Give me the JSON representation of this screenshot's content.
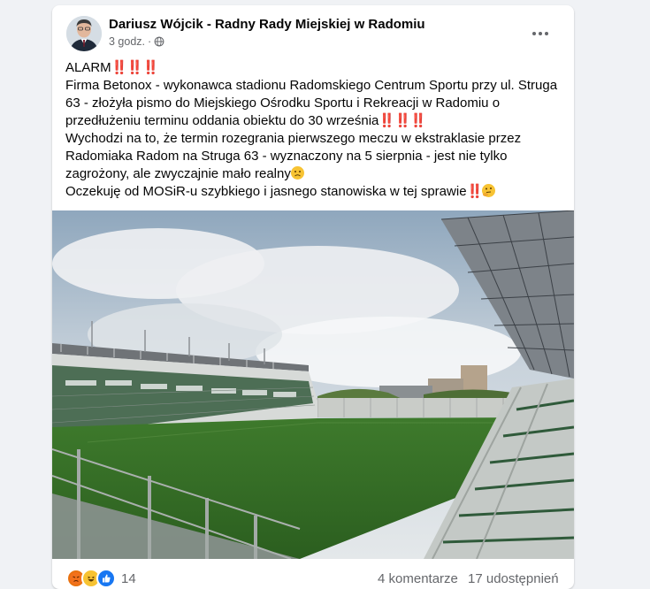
{
  "post": {
    "author": "Dariusz Wójcik - Radny Rady Miejskiej w Radomiu",
    "time": "3 godz.",
    "separator": "·",
    "audience_icon": "globe-icon",
    "more_icon": "more-options-icon",
    "text": {
      "line1_word": "ALARM",
      "alarm_marks": "‼️‼️‼️",
      "para1": "Firma Betonox - wykonawca stadionu Radomskiego Centrum Sportu przy ul. Struga 63 - złożyła pismo do Miejskiego Ośrodku Sportu i Rekreacji w Radomiu o przedłużeniu terminu oddania obiektu do 30 września",
      "para1_marks": "‼️‼️‼️",
      "para2": "Wychodzi na to, że termin rozegrania pierwszego meczu w ekstraklasie przez Radomiaka Radom na Struga 63 - wyznaczony na 5 sierpnia - jest nie tylko zagrożony, ale zwyczajnie mało realny",
      "para3": "Oczekuję od MOSiR-u szybkiego i jasnego stanowiska w tej sprawie",
      "para3_marks": "‼️"
    },
    "photo_alt": "Stadium photo"
  },
  "footer": {
    "reactions_count": "14",
    "comments": "4 komentarze",
    "shares": "17 udostępnień"
  },
  "colors": {
    "background": "#f0f2f5",
    "card": "#ffffff",
    "secondary_text": "#65676b",
    "alarm_red": "#e0245e"
  }
}
